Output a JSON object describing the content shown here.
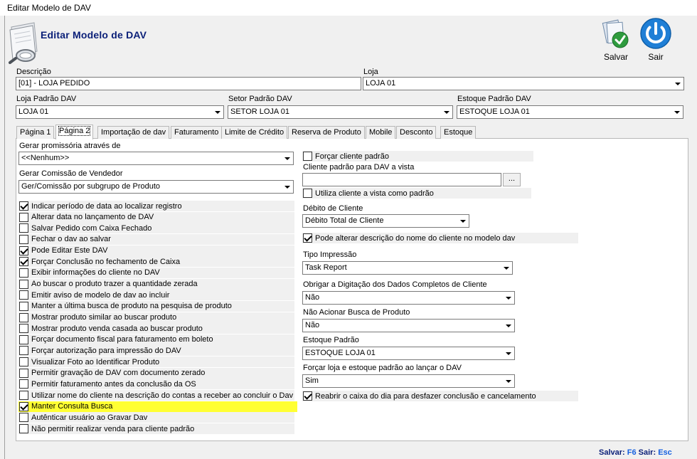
{
  "window": {
    "title": "Editar Modelo de DAV"
  },
  "header": {
    "title": "Editar Modelo de DAV"
  },
  "toolbar": {
    "save_label": "Salvar",
    "exit_label": "Sair"
  },
  "form": {
    "descricao": {
      "label": "Descrição",
      "value": "[01] - LOJA PEDIDO"
    },
    "loja": {
      "label": "Loja",
      "value": "LOJA 01"
    },
    "loja_padrao": {
      "label": "Loja Padrão DAV",
      "value": "LOJA 01"
    },
    "setor_padrao": {
      "label": "Setor Padrão DAV",
      "value": "SETOR LOJA 01"
    },
    "estoque_padrao": {
      "label": "Estoque Padrão DAV",
      "value": "ESTOQUE LOJA 01"
    }
  },
  "tabs": [
    {
      "label": "Página 1"
    },
    {
      "label": "Página 2"
    },
    {
      "label": "Importação de dav"
    },
    {
      "label": "Faturamento"
    },
    {
      "label": "Limite de Crédito"
    },
    {
      "label": "Reserva de Produto"
    },
    {
      "label": "Mobile"
    },
    {
      "label": "Desconto"
    },
    {
      "label": "Estoque"
    }
  ],
  "left": {
    "promissoria": {
      "label": "Gerar promissória através de",
      "value": "<<Nenhum>>"
    },
    "comissao": {
      "label": "Gerar Comissão de Vendedor",
      "value": "Ger/Comissão por subgrupo de Produto"
    },
    "checks": [
      {
        "label": "Indicar período de data ao localizar registro",
        "checked": true
      },
      {
        "label": "Alterar data no lançamento de DAV",
        "checked": false
      },
      {
        "label": "Salvar Pedido com Caixa Fechado",
        "checked": false
      },
      {
        "label": "Fechar o dav ao salvar",
        "checked": false
      },
      {
        "label": "Pode Editar Este DAV",
        "checked": true
      },
      {
        "label": "Forçar Conclusão no fechamento de Caixa",
        "checked": true
      },
      {
        "label": "Exibir informações do cliente no DAV",
        "checked": false
      },
      {
        "label": "Ao buscar o produto trazer a quantidade zerada",
        "checked": false
      },
      {
        "label": "Emitir aviso de modelo de dav ao incluir",
        "checked": false
      },
      {
        "label": "Manter a última busca de produto na pesquisa de produto",
        "checked": false
      },
      {
        "label": "Mostrar produto similar ao buscar produto",
        "checked": false
      },
      {
        "label": "Mostrar produto venda casada ao buscar produto",
        "checked": false
      },
      {
        "label": "Forçar documento fiscal para faturamento em boleto",
        "checked": false
      },
      {
        "label": "Forçar autorização para impressão do DAV",
        "checked": false
      },
      {
        "label": "Visualizar Foto ao Identificar Produto",
        "checked": false
      },
      {
        "label": "Permitir gravação de DAV com documento zerado",
        "checked": false
      },
      {
        "label": "Permitir faturamento antes da conclusão da OS",
        "checked": false
      },
      {
        "label": "Utilizar nome do cliente na descrição do contas a receber ao concluir o Dav",
        "checked": false
      },
      {
        "label": "Manter Consulta Busca",
        "checked": true,
        "highlight": true
      },
      {
        "label": "Autênticar usuário ao Gravar Dav",
        "checked": false
      },
      {
        "label": "Não permitir realizar venda para cliente padrão",
        "checked": false
      }
    ]
  },
  "right": {
    "forcar_cliente": {
      "label": "Forçar cliente padrão",
      "checked": false
    },
    "cliente_padrao": {
      "label": "Cliente padrão para DAV a vista",
      "value": "",
      "button": "..."
    },
    "utiliza_cliente": {
      "label": "Utiliza cliente a vista como padrão",
      "checked": false
    },
    "debito": {
      "label": "Débito de Cliente",
      "value": "Débito Total de Cliente"
    },
    "alterar_desc": {
      "label": "Pode alterar descrição do nome do cliente no modelo dav",
      "checked": true
    },
    "tipo_impressao": {
      "label": "Tipo Impressão",
      "value": "Task Report"
    },
    "obrigar_digitacao": {
      "label": "Obrigar a Digitação dos Dados Completos de Cliente",
      "value": "Não"
    },
    "nao_acionar": {
      "label": "Não Acionar Busca de Produto",
      "value": "Não"
    },
    "estoque_padrao": {
      "label": "Estoque Padrão",
      "value": "ESTOQUE LOJA 01"
    },
    "forcar_loja": {
      "label": "Forçar loja e estoque padrão ao lançar o DAV",
      "value": "Sim"
    },
    "reabrir": {
      "label": "Reabrir o caixa do dia para desfazer conclusão e cancelamento",
      "checked": true
    }
  },
  "status": {
    "save_text": "Salvar:",
    "save_key": "F6",
    "exit_text": "Sair:",
    "exit_key": "Esc"
  },
  "colors": {
    "title_blue": "#0a1f78",
    "highlight": "#ffff33",
    "key_blue": "#1560e0"
  }
}
